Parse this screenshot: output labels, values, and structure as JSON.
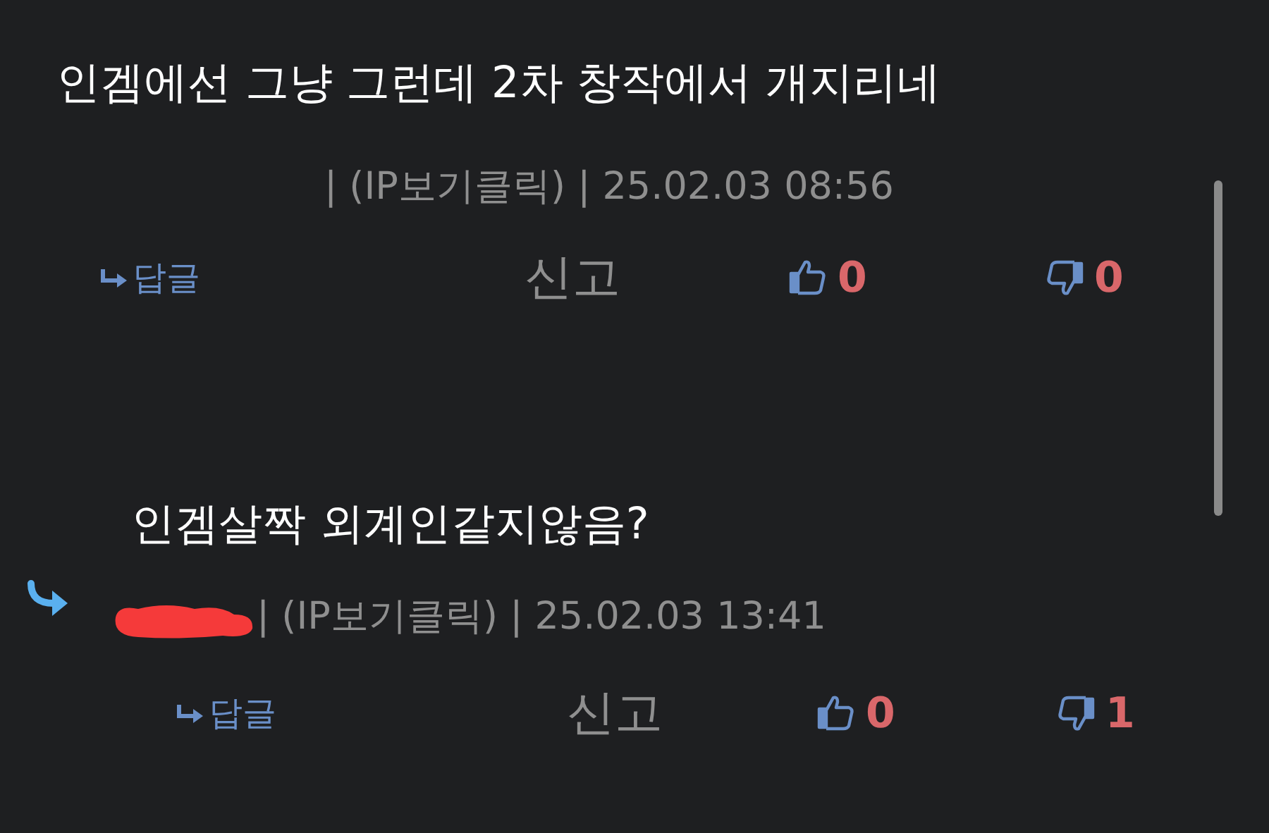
{
  "comments": [
    {
      "kind": "comment",
      "text": "인겜에선 그냥 그런데 2차 창작에서 개지리네",
      "author_redacted": false,
      "meta": "| (IP보기클릭) | 25.02.03 08:56",
      "reply_label": "답글",
      "report_label": "신고",
      "likes": "0",
      "dislikes": "0"
    },
    {
      "kind": "reply",
      "text": "인겜살짝 외계인같지않음?",
      "author_redacted": true,
      "meta": "| (IP보기클릭) | 25.02.03 13:41",
      "reply_label": "답글",
      "report_label": "신고",
      "likes": "0",
      "dislikes": "1"
    }
  ]
}
